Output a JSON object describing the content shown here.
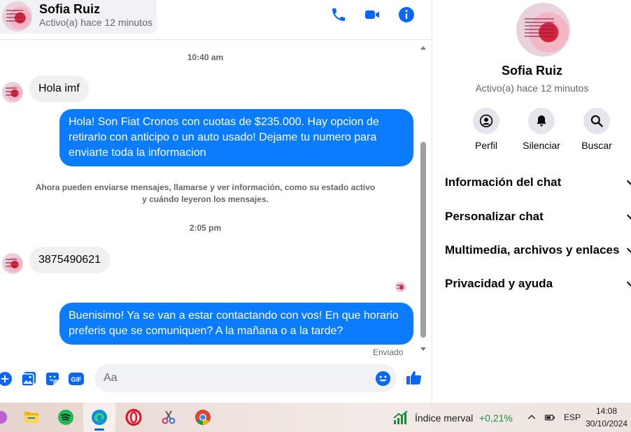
{
  "contact": {
    "name": "Sofia Ruiz",
    "status": "Activo(a) hace 12 minutos"
  },
  "header_icons": [
    "phone-icon",
    "video-camera-icon",
    "info-icon"
  ],
  "messages": {
    "time1": "10:40 am",
    "m1": "Hola imf",
    "m2": "Hola! Son Fiat Cronos con cuotas de $235.000. Hay opcion de retirarlo con anticipo o un auto usado! Dejame tu numero para enviarte toda la informacion",
    "system": "Ahora pueden enviarse mensajes, llamarse y ver información, como su estado activo y cuándo leyeron los mensajes.",
    "time2": "2:05 pm",
    "m3": "3875490621",
    "m4": "Buenisimo! Ya se van a estar contactando con vos! En que horario preferis que se comuniquen? A la mañana o a la tarde?",
    "sent_status": "Enviado"
  },
  "composer": {
    "placeholder": "Aa",
    "gif_label": "GIF"
  },
  "panel": {
    "actions": [
      {
        "label": "Perfil"
      },
      {
        "label": "Silenciar"
      },
      {
        "label": "Buscar"
      }
    ],
    "sections": [
      {
        "label": "Información del chat"
      },
      {
        "label": "Personalizar chat"
      },
      {
        "label": "Multimedia, archivos y enlaces"
      },
      {
        "label": "Privacidad y ayuda"
      }
    ]
  },
  "taskbar": {
    "stock_name": "Índice merval",
    "stock_change": "+0,21%",
    "language": "ESP",
    "time": "14:08",
    "date": "30/10/2024"
  },
  "colors": {
    "accent": "#0a7cff",
    "icon_blue": "#0866ff",
    "incoming_bubble": "#f0f0f0",
    "stock_green": "#1e8e3e"
  }
}
